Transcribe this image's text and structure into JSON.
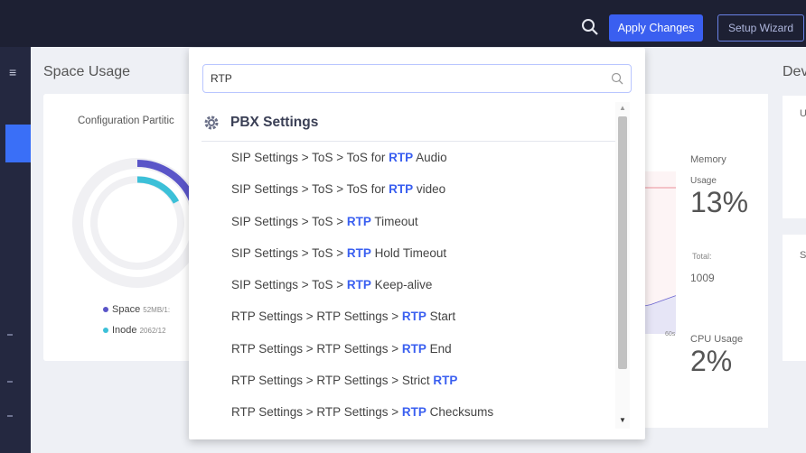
{
  "topbar": {
    "search_icon": "search-icon",
    "apply_label": "Apply Changes",
    "wizard_label": "Setup Wizard"
  },
  "dashboard": {
    "space_title": "Space Usage",
    "dev_title": "Dev",
    "config_label": "Configuration Partitic",
    "legend": {
      "space_label": "Space",
      "space_value": "52MB/1:",
      "inode_label": "Inode",
      "inode_value": "2062/12"
    },
    "memory": {
      "label": "Memory",
      "usage_label": "Usage",
      "percent": "13%",
      "total_label": "Total:",
      "total_value": "1009"
    },
    "cpu": {
      "label": "CPU Usage",
      "percent": "2%"
    },
    "axis_tick": "60s",
    "right_card1_label": "U",
    "right_card2_label": "S"
  },
  "dropdown": {
    "search_value": "RTP",
    "group_title": "PBX Settings",
    "group_icon": "gear-icon",
    "results": [
      {
        "pre": "SIP Settings > ToS > ToS for ",
        "hl": "RTP",
        "post": " Audio"
      },
      {
        "pre": "SIP Settings > ToS > ToS for ",
        "hl": "RTP",
        "post": " video"
      },
      {
        "pre": "SIP Settings > ToS > ",
        "hl": "RTP",
        "post": " Timeout"
      },
      {
        "pre": "SIP Settings > ToS > ",
        "hl": "RTP",
        "post": " Hold Timeout"
      },
      {
        "pre": "SIP Settings > ToS > ",
        "hl": "RTP",
        "post": " Keep-alive"
      },
      {
        "pre": "RTP Settings > RTP Settings > ",
        "hl": "RTP",
        "post": " Start"
      },
      {
        "pre": "RTP Settings > RTP Settings > ",
        "hl": "RTP",
        "post": " End"
      },
      {
        "pre": "RTP Settings > RTP Settings > Strict ",
        "hl": "RTP",
        "post": ""
      },
      {
        "pre": "RTP Settings > RTP Settings > ",
        "hl": "RTP",
        "post": " Checksums"
      }
    ]
  },
  "colors": {
    "accent": "#3a5ff0",
    "topbar": "#1d2033",
    "donut_space": "#5a55c8",
    "donut_inode": "#3cc0d8"
  }
}
